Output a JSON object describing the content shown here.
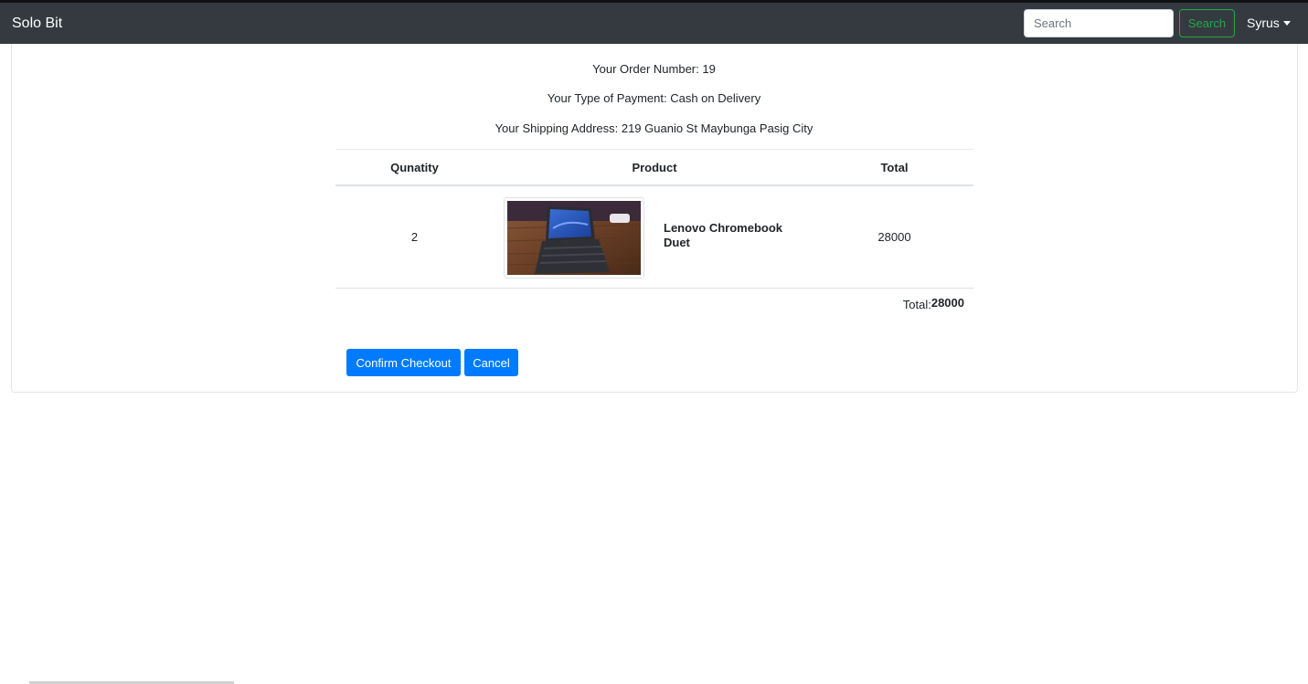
{
  "navbar": {
    "brand": "Solo Bit",
    "search_placeholder": "Search",
    "search_button": "Search",
    "user": "Syrus"
  },
  "order": {
    "number_line": "Your Order Number: 19",
    "payment_line": "Your Type of Payment: Cash on Delivery",
    "address_line": "Your Shipping Address: 219 Guanio St Maybunga Pasig City"
  },
  "table": {
    "headers": [
      "Qunatity",
      "Product",
      "Total"
    ],
    "rows": [
      {
        "quantity": "2",
        "product_line1": "Lenovo Chromebook",
        "product_line2": "Duet",
        "total": "28000"
      }
    ],
    "total_label": "Total:",
    "total_value": "28000"
  },
  "actions": {
    "confirm": "Confirm Checkout",
    "cancel": "Cancel"
  },
  "colors": {
    "navbar_bg": "#343a40",
    "primary": "#007bff",
    "success": "#28a745"
  }
}
